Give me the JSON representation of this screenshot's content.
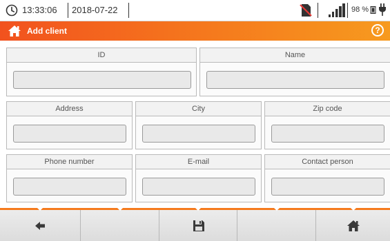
{
  "status": {
    "time": "13:33:06",
    "date": "2018-07-22",
    "battery_percent": "98 %",
    "icons": [
      "clock-icon",
      "sd-card-missing-icon",
      "signal-bars-icon",
      "battery-icon",
      "power-plug-icon"
    ]
  },
  "header": {
    "title": "Add client",
    "home_icon": "home-icon",
    "help_symbol": "?"
  },
  "form": {
    "id_label": "ID",
    "name_label": "Name",
    "address_label": "Address",
    "city_label": "City",
    "zip_label": "Zip code",
    "phone_label": "Phone number",
    "email_label": "E-mail",
    "contact_label": "Contact person",
    "values": {
      "id": "",
      "name": "",
      "address": "",
      "city": "",
      "zip": "",
      "phone": "",
      "email": "",
      "contact": ""
    }
  },
  "toolbar": {
    "buttons": [
      "back-arrow-icon",
      "",
      "save-disk-icon",
      "",
      "home-icon"
    ]
  },
  "colors": {
    "accent": "#f57a1d",
    "accent_start": "#f2521e",
    "toolbar_bg": "#e2e2e2",
    "field_bg": "#e9e9e9"
  }
}
